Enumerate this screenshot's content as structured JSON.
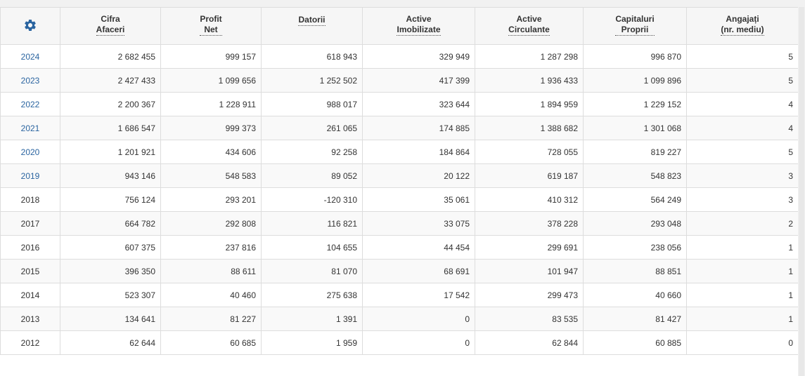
{
  "accent_color": "#2a64a0",
  "settings_icon": "gear-icon",
  "headers": [
    {
      "line1": "Cifra",
      "line2": "Afaceri"
    },
    {
      "line1": "Profit",
      "line2": "Net"
    },
    {
      "line1": "Datorii",
      "line2": ""
    },
    {
      "line1": "Active",
      "line2": "Imobilizate"
    },
    {
      "line1": "Active",
      "line2": "Circulante"
    },
    {
      "line1": "Capitaluri",
      "line2": "Proprii"
    },
    {
      "line1": "Angajați",
      "line2": "(nr. mediu)"
    }
  ],
  "rows": [
    {
      "year": "2024",
      "linked": true,
      "values": [
        "2 682 455",
        "999 157",
        "618 943",
        "329 949",
        "1 287 298",
        "996 870",
        "5"
      ]
    },
    {
      "year": "2023",
      "linked": true,
      "values": [
        "2 427 433",
        "1 099 656",
        "1 252 502",
        "417 399",
        "1 936 433",
        "1 099 896",
        "5"
      ]
    },
    {
      "year": "2022",
      "linked": true,
      "values": [
        "2 200 367",
        "1 228 911",
        "988 017",
        "323 644",
        "1 894 959",
        "1 229 152",
        "4"
      ]
    },
    {
      "year": "2021",
      "linked": true,
      "values": [
        "1 686 547",
        "999 373",
        "261 065",
        "174 885",
        "1 388 682",
        "1 301 068",
        "4"
      ]
    },
    {
      "year": "2020",
      "linked": true,
      "values": [
        "1 201 921",
        "434 606",
        "92 258",
        "184 864",
        "728 055",
        "819 227",
        "5"
      ]
    },
    {
      "year": "2019",
      "linked": true,
      "values": [
        "943 146",
        "548 583",
        "89 052",
        "20 122",
        "619 187",
        "548 823",
        "3"
      ]
    },
    {
      "year": "2018",
      "linked": false,
      "values": [
        "756 124",
        "293 201",
        "-120 310",
        "35 061",
        "410 312",
        "564 249",
        "3"
      ]
    },
    {
      "year": "2017",
      "linked": false,
      "values": [
        "664 782",
        "292 808",
        "116 821",
        "33 075",
        "378 228",
        "293 048",
        "2"
      ]
    },
    {
      "year": "2016",
      "linked": false,
      "values": [
        "607 375",
        "237 816",
        "104 655",
        "44 454",
        "299 691",
        "238 056",
        "1"
      ]
    },
    {
      "year": "2015",
      "linked": false,
      "values": [
        "396 350",
        "88 611",
        "81 070",
        "68 691",
        "101 947",
        "88 851",
        "1"
      ]
    },
    {
      "year": "2014",
      "linked": false,
      "values": [
        "523 307",
        "40 460",
        "275 638",
        "17 542",
        "299 473",
        "40 660",
        "1"
      ]
    },
    {
      "year": "2013",
      "linked": false,
      "values": [
        "134 641",
        "81 227",
        "1 391",
        "0",
        "83 535",
        "81 427",
        "1"
      ]
    },
    {
      "year": "2012",
      "linked": false,
      "values": [
        "62 644",
        "60 685",
        "1 959",
        "0",
        "62 844",
        "60 885",
        "0"
      ]
    }
  ]
}
